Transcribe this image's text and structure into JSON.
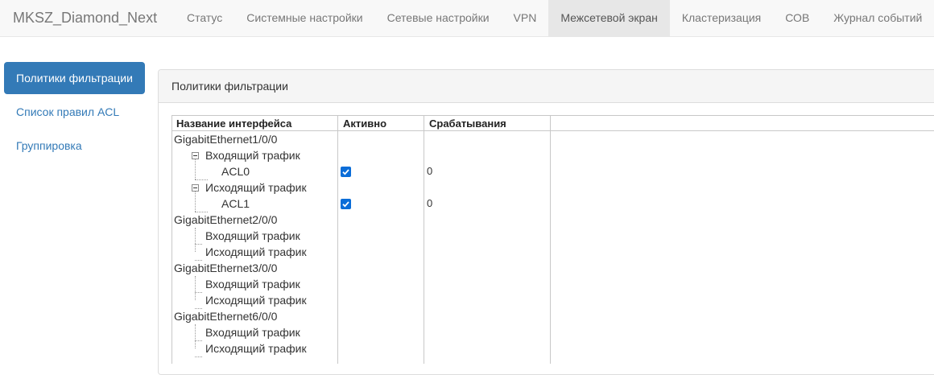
{
  "navbar": {
    "brand": "MKSZ_Diamond_Next",
    "items": [
      {
        "label": "Статус"
      },
      {
        "label": "Системные настройки"
      },
      {
        "label": "Сетевые настройки"
      },
      {
        "label": "VPN"
      },
      {
        "label": "Межсетевой экран"
      },
      {
        "label": "Кластеризация"
      },
      {
        "label": "СОВ"
      },
      {
        "label": "Журнал событий"
      }
    ]
  },
  "sidebar": {
    "items": [
      {
        "label": "Политики фильтрации"
      },
      {
        "label": "Список правил ACL"
      },
      {
        "label": "Группировка"
      }
    ]
  },
  "panel": {
    "title": "Политики фильтрации"
  },
  "table": {
    "columns": [
      "Название интерфейса",
      "Активно",
      "Срабатывания"
    ],
    "rows": [
      {
        "name": "GigabitEthernet1/0/0",
        "active": null,
        "count": ""
      },
      {
        "name": "Входящий трафик",
        "active": null,
        "count": ""
      },
      {
        "name": "ACL0",
        "active": true,
        "count": "0"
      },
      {
        "name": "Исходящий трафик",
        "active": null,
        "count": ""
      },
      {
        "name": "ACL1",
        "active": true,
        "count": "0"
      },
      {
        "name": "GigabitEthernet2/0/0",
        "active": null,
        "count": ""
      },
      {
        "name": "Входящий трафик",
        "active": null,
        "count": ""
      },
      {
        "name": "Исходящий трафик",
        "active": null,
        "count": ""
      },
      {
        "name": "GigabitEthernet3/0/0",
        "active": null,
        "count": ""
      },
      {
        "name": "Входящий трафик",
        "active": null,
        "count": ""
      },
      {
        "name": "Исходящий трафик",
        "active": null,
        "count": ""
      },
      {
        "name": "GigabitEthernet6/0/0",
        "active": null,
        "count": ""
      },
      {
        "name": "Входящий трафик",
        "active": null,
        "count": ""
      },
      {
        "name": "Исходящий трафик",
        "active": null,
        "count": ""
      }
    ]
  },
  "colors": {
    "accent": "#337ab7",
    "checkbox": "#0b6dd8"
  }
}
